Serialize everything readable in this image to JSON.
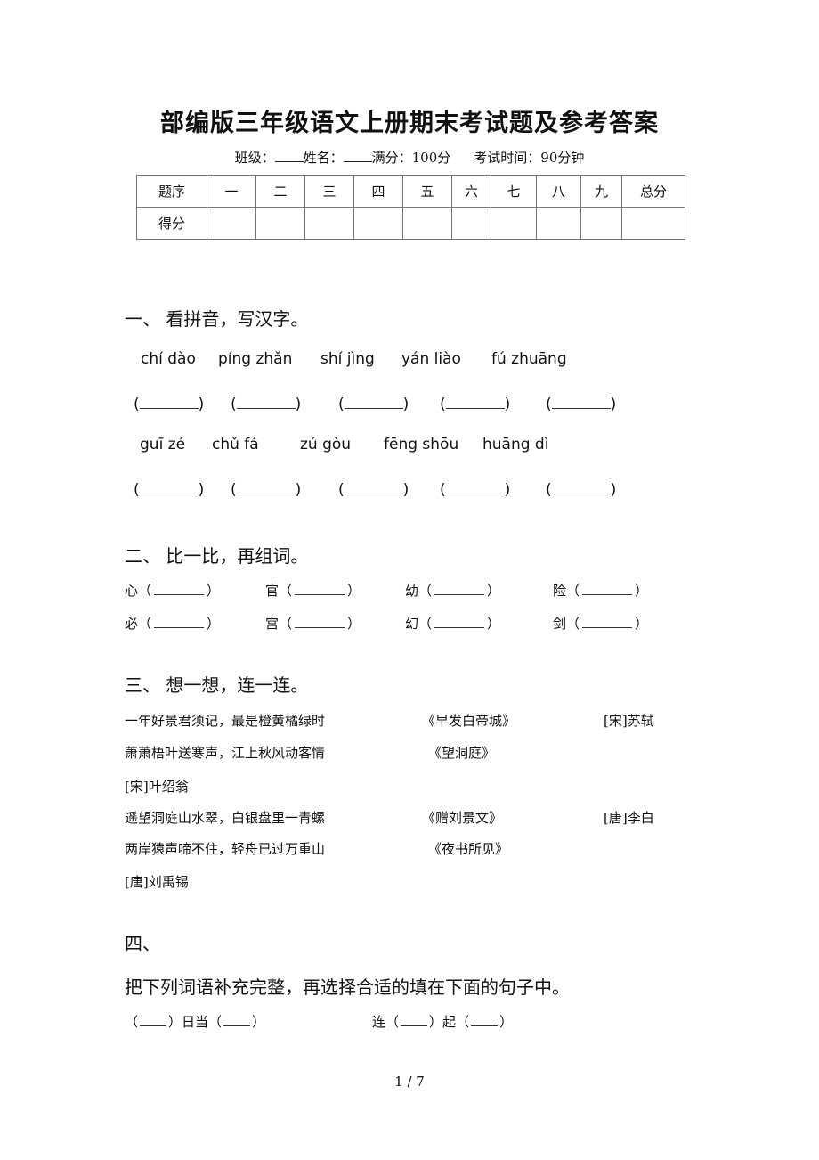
{
  "title": "部编版三年级语文上册期末考试题及参考答案",
  "meta": {
    "class_label": "班级：",
    "name_label": "姓名：",
    "full_score": "满分：100分",
    "time": "考试时间：90分钟"
  },
  "score_table": {
    "header": [
      "题序",
      "一",
      "二",
      "三",
      "四",
      "五",
      "六",
      "七",
      "八",
      "九",
      "总分"
    ],
    "row_label": "得分"
  },
  "q1": {
    "heading": "一、  看拼音，写汉字。",
    "row1": [
      "chí dào",
      "píng zhǎn",
      "shí  jìng",
      "yán  liào",
      "fú zhuāng"
    ],
    "row2": [
      "guī zé",
      "chǔ  fá",
      "zú  gòu",
      "fēng shōu",
      "huāng dì"
    ],
    "paren_open": "(",
    "paren_close": ")"
  },
  "q2": {
    "heading": "二、  比一比，再组词。",
    "row1": [
      "心",
      "官",
      "幼",
      "险"
    ],
    "row2": [
      "必",
      "宫",
      "幻",
      "剑"
    ],
    "paren_open": "（",
    "paren_close": "）"
  },
  "q3": {
    "heading": "三、  想一想，连一连。",
    "lines": [
      {
        "poem": "一年好景君须记，最是橙黄橘绿时",
        "title": "《早发白帝城》",
        "author": "[宋]苏轼"
      },
      {
        "poem": "萧萧梧叶送寒声，江上秋风动客情",
        "title": "《望洞庭》",
        "author": ""
      },
      {
        "poem": "[宋]叶绍翁",
        "title": "",
        "author": ""
      },
      {
        "poem": "遥望洞庭山水翠，白银盘里一青螺",
        "title": "《赠刘景文》",
        "author": "[唐]李白"
      },
      {
        "poem": "两岸猿声啼不住，轻舟已过万重山",
        "title": "《夜书所见》",
        "author": ""
      },
      {
        "poem": "[唐]刘禹锡",
        "title": "",
        "author": ""
      }
    ]
  },
  "q4": {
    "heading": "四、",
    "instruction": "把下列词语补充完整，再选择合适的填在下面的句子中。",
    "item1": {
      "mid": "日当"
    },
    "item2": {
      "pre": "连",
      "mid": "起"
    },
    "paren_open": "（",
    "paren_close": "）"
  },
  "page_number": "1 / 7"
}
